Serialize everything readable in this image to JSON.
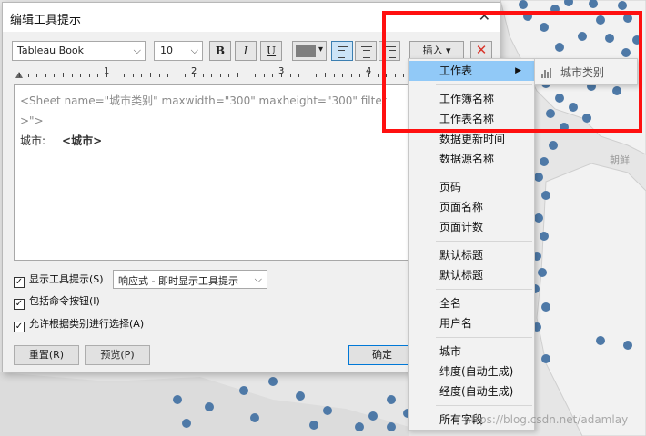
{
  "dialog": {
    "title": "编辑工具提示",
    "close": "✕"
  },
  "toolbar": {
    "font_family": "Tableau Book",
    "font_size": "10",
    "bold": "B",
    "italic": "I",
    "underline": "U",
    "insert_label": "插入 ▾",
    "delete_label": "✕",
    "text_color": "#7f7f7f"
  },
  "ruler": {
    "numbers": [
      "1",
      "2",
      "3",
      "4"
    ]
  },
  "editor": {
    "tag_line": "<Sheet name=\"城市类别\" maxwidth=\"300\" maxheight=\"300\" filter",
    "tag_line2": ">\">",
    "field_label": "城市:",
    "field_token": "<城市>"
  },
  "options": {
    "show_tooltip": "显示工具提示(S)",
    "mode_select": "响应式 - 即时显示工具提示",
    "include_buttons": "包括命令按钮(I)",
    "allow_selection": "允许根据类别进行选择(A)"
  },
  "buttons": {
    "reset": "重置(R)",
    "preview": "预览(P)",
    "ok": "确定"
  },
  "menu": {
    "items": [
      "工作表",
      "工作簿名称",
      "工作表名称",
      "数据更新时间",
      "数据源名称",
      "页码",
      "页面名称",
      "页面计数",
      "默认标题",
      "默认标题",
      "全名",
      "用户名",
      "城市",
      "纬度(自动生成)",
      "经度(自动生成)",
      "所有字段"
    ]
  },
  "submenu": {
    "item": "城市类别"
  },
  "map": {
    "watermark": "https://blog.csdn.net/adamlay",
    "place_label": "朝鲜",
    "dot_color": "#4e79a7",
    "land_color": "#ededed"
  },
  "highlight_color": "#ff1010"
}
